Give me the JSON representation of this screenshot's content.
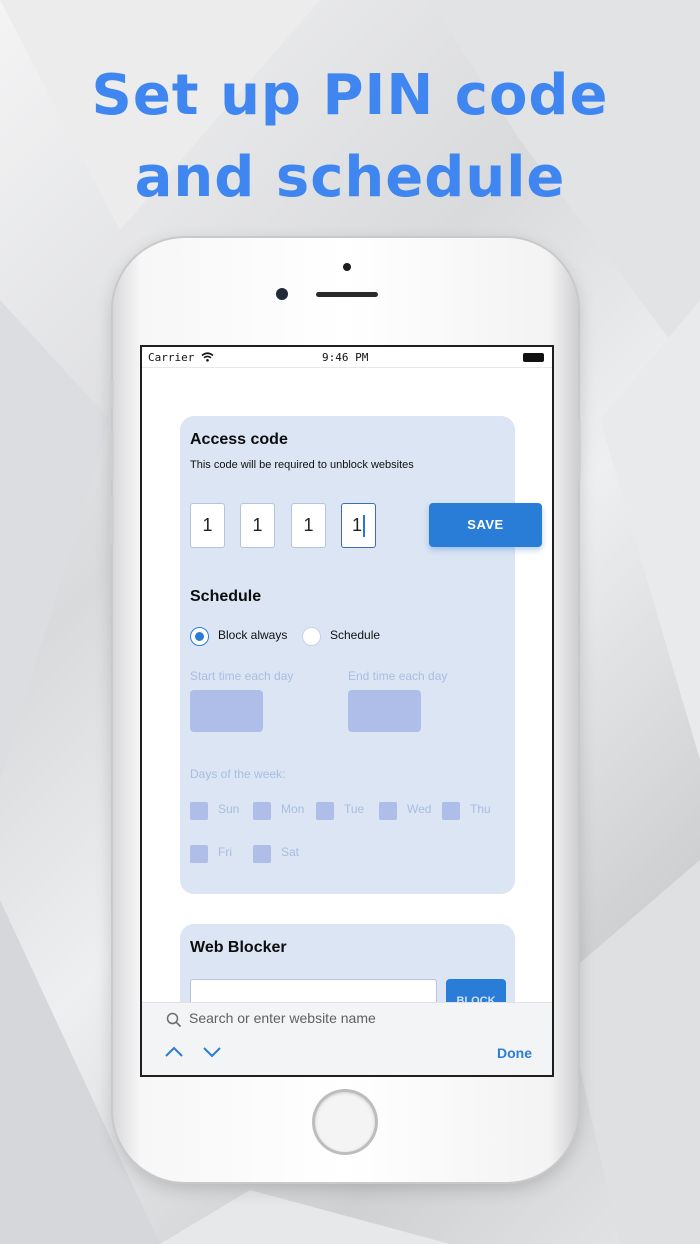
{
  "headline": {
    "line1": "Set up PIN code",
    "line2": "and schedule"
  },
  "status_bar": {
    "carrier": "Carrier",
    "time": "9:46 PM"
  },
  "access_code": {
    "title": "Access code",
    "subtitle": "This code will be required to unblock websites",
    "digits": [
      "1",
      "1",
      "1",
      "1"
    ],
    "save_label": "SAVE"
  },
  "schedule": {
    "title": "Schedule",
    "options": [
      {
        "label": "Block always",
        "selected": true
      },
      {
        "label": "Schedule",
        "selected": false
      }
    ],
    "start_label": "Start time each day",
    "end_label": "End time each day",
    "days_label": "Days of the week:",
    "days": [
      "Sun",
      "Mon",
      "Tue",
      "Wed",
      "Thu",
      "Fri",
      "Sat"
    ]
  },
  "web_blocker": {
    "title": "Web Blocker",
    "input_value": "",
    "block_label": "BLOCK"
  },
  "keyboard_bar": {
    "search_placeholder": "Search or enter website name",
    "done_label": "Done"
  },
  "colors": {
    "headline": "#3f86f0",
    "accent": "#2a7dd6",
    "card_bg": "#dbe5f3",
    "disabled": "#aebee9"
  },
  "icons": [
    "wifi-icon",
    "battery-icon",
    "search-icon",
    "chevron-up-icon",
    "chevron-down-icon"
  ]
}
